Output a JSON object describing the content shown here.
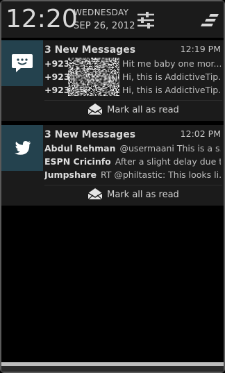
{
  "status": {
    "time": "12:20",
    "day_of_week": "WEDNESDAY",
    "date": "SEP 26, 2012",
    "settings_icon": "settings-sliders-icon",
    "clear_icon": "clear-all-icon"
  },
  "notifications": [
    {
      "app": "messaging",
      "icon": "sms-bubble-icon",
      "title": "3 New Messages",
      "time": "12:19 PM",
      "items": [
        {
          "sender": "+923",
          "message": "Hit me baby one mor..."
        },
        {
          "sender": "+923",
          "message": "Hi, this is AddictiveTip..."
        },
        {
          "sender": "+923",
          "message": "Hi, this is AddictiveTip..."
        }
      ],
      "action_label": "Mark all as read",
      "action_icon": "envelope-open-icon"
    },
    {
      "app": "twitter",
      "icon": "twitter-bird-icon",
      "title": "3 New Messages",
      "time": "12:02 PM",
      "items": [
        {
          "sender": "Abdul Rehman",
          "message": "@usermaani This is a s..."
        },
        {
          "sender": "ESPN Cricinfo",
          "message": "After a slight delay due t..."
        },
        {
          "sender": "Jumpshare",
          "message": "RT @philtastic: This looks li..."
        }
      ],
      "action_label": "Mark all as read",
      "action_icon": "envelope-open-icon"
    }
  ],
  "colors": {
    "background": "#000000",
    "card": "#1b1b1b",
    "icon_tile": "#24424e",
    "text": "#d8d8d8"
  }
}
